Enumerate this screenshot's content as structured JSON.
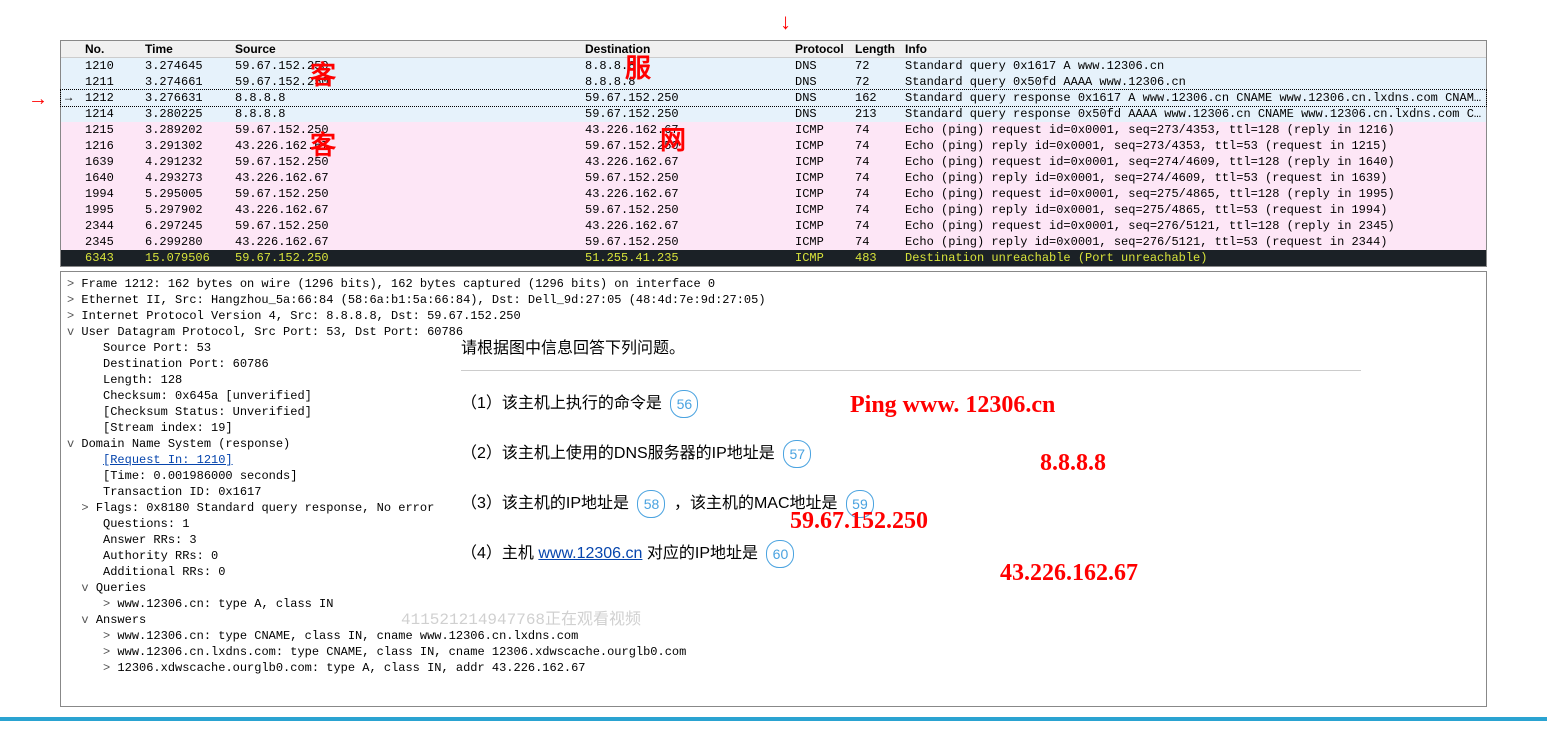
{
  "columns": {
    "no": "No.",
    "time": "Time",
    "source": "Source",
    "destination": "Destination",
    "protocol": "Protocol",
    "length": "Length",
    "info": "Info"
  },
  "packets": [
    {
      "no": "1210",
      "time": "3.274645",
      "src": "59.67.152.250",
      "dst": "8.8.8.8",
      "proto": "DNS",
      "len": "72",
      "info": "Standard query 0x1617 A www.12306.cn",
      "cls": "row-blue"
    },
    {
      "no": "1211",
      "time": "3.274661",
      "src": "59.67.152.250",
      "dst": "8.8.8.8",
      "proto": "DNS",
      "len": "72",
      "info": "Standard query 0x50fd AAAA www.12306.cn",
      "cls": "row-blue"
    },
    {
      "no": "1212",
      "time": "3.276631",
      "src": "8.8.8.8",
      "dst": "59.67.152.250",
      "proto": "DNS",
      "len": "162",
      "info": "Standard query response 0x1617 A www.12306.cn CNAME www.12306.cn.lxdns.com CNAME 12306.xdwscache.ourglb0.com …",
      "cls": "row-blue selected"
    },
    {
      "no": "1214",
      "time": "3.280225",
      "src": "8.8.8.8",
      "dst": "59.67.152.250",
      "proto": "DNS",
      "len": "213",
      "info": "Standard query response 0x50fd AAAA www.12306.cn CNAME www.12306.cn.lxdns.com CNAME 12306.xdwscache.ourglb0.c…",
      "cls": "row-blue"
    },
    {
      "no": "1215",
      "time": "3.289202",
      "src": "59.67.152.250",
      "dst": "43.226.162.67",
      "proto": "ICMP",
      "len": "74",
      "info": "Echo (ping) request  id=0x0001, seq=273/4353, ttl=128 (reply in 1216)",
      "cls": "row-pink"
    },
    {
      "no": "1216",
      "time": "3.291302",
      "src": "43.226.162.67",
      "dst": "59.67.152.250",
      "proto": "ICMP",
      "len": "74",
      "info": "Echo (ping) reply    id=0x0001, seq=273/4353, ttl=53 (request in 1215)",
      "cls": "row-pink"
    },
    {
      "no": "1639",
      "time": "4.291232",
      "src": "59.67.152.250",
      "dst": "43.226.162.67",
      "proto": "ICMP",
      "len": "74",
      "info": "Echo (ping) request  id=0x0001, seq=274/4609, ttl=128 (reply in 1640)",
      "cls": "row-pink"
    },
    {
      "no": "1640",
      "time": "4.293273",
      "src": "43.226.162.67",
      "dst": "59.67.152.250",
      "proto": "ICMP",
      "len": "74",
      "info": "Echo (ping) reply    id=0x0001, seq=274/4609, ttl=53 (request in 1639)",
      "cls": "row-pink"
    },
    {
      "no": "1994",
      "time": "5.295005",
      "src": "59.67.152.250",
      "dst": "43.226.162.67",
      "proto": "ICMP",
      "len": "74",
      "info": "Echo (ping) request  id=0x0001, seq=275/4865, ttl=128 (reply in 1995)",
      "cls": "row-pink"
    },
    {
      "no": "1995",
      "time": "5.297902",
      "src": "43.226.162.67",
      "dst": "59.67.152.250",
      "proto": "ICMP",
      "len": "74",
      "info": "Echo (ping) reply    id=0x0001, seq=275/4865, ttl=53 (request in 1994)",
      "cls": "row-pink"
    },
    {
      "no": "2344",
      "time": "6.297245",
      "src": "59.67.152.250",
      "dst": "43.226.162.67",
      "proto": "ICMP",
      "len": "74",
      "info": "Echo (ping) request  id=0x0001, seq=276/5121, ttl=128 (reply in 2345)",
      "cls": "row-pink"
    },
    {
      "no": "2345",
      "time": "6.299280",
      "src": "43.226.162.67",
      "dst": "59.67.152.250",
      "proto": "ICMP",
      "len": "74",
      "info": "Echo (ping) reply    id=0x0001, seq=276/5121, ttl=53 (request in 2344)",
      "cls": "row-pink"
    },
    {
      "no": "6343",
      "time": "15.079506",
      "src": "59.67.152.250",
      "dst": "51.255.41.235",
      "proto": "ICMP",
      "len": "483",
      "info": "Destination unreachable (Port unreachable)",
      "cls": "row-dark"
    }
  ],
  "tree": {
    "frame": "Frame 1212: 162 bytes on wire (1296 bits), 162 bytes captured (1296 bits) on interface 0",
    "eth": "Ethernet II, Src: Hangzhou_5a:66:84 (58:6a:b1:5a:66:84), Dst: Dell_9d:27:05 (48:4d:7e:9d:27:05)",
    "ip": "Internet Protocol Version 4, Src: 8.8.8.8, Dst: 59.67.152.250",
    "udp": "User Datagram Protocol, Src Port: 53, Dst Port: 60786",
    "srcport": "Source Port: 53",
    "dstport": "Destination Port: 60786",
    "length": "Length: 128",
    "cksum": "Checksum: 0x645a [unverified]",
    "ckstat": "[Checksum Status: Unverified]",
    "stream": "[Stream index: 19]",
    "dns": "Domain Name System (response)",
    "reqin": "[Request In: 1210]",
    "time": "[Time: 0.001986000 seconds]",
    "tid": "Transaction ID: 0x1617",
    "flags": "Flags: 0x8180 Standard query response, No error",
    "qcount": "Questions: 1",
    "arrs": "Answer RRs: 3",
    "aurrs": "Authority RRs: 0",
    "adrrs": "Additional RRs: 0",
    "queries": "Queries",
    "query0": "www.12306.cn: type A, class IN",
    "answers": "Answers",
    "ans0": "www.12306.cn: type CNAME, class IN, cname www.12306.cn.lxdns.com",
    "ans1": "www.12306.cn.lxdns.com: type CNAME, class IN, cname 12306.xdwscache.ourglb0.com",
    "ans2": "12306.xdwscache.ourglb0.com: type A, class IN, addr 43.226.162.67"
  },
  "questions": {
    "prompt": "请根据图中信息回答下列问题。",
    "q1_pre": "（1）该主机上执行的命令是",
    "q1_num": "56",
    "q2_pre": "（2）该主机上使用的DNS服务器的IP地址是",
    "q2_num": "57",
    "q3_pre": "（3）该主机的IP地址是",
    "q3_num": "58",
    "q3_mid": "，该主机的MAC地址是",
    "q3_num2": "59",
    "q4_pre": "（4）主机",
    "q4_link": "www.12306.cn",
    "q4_post": "对应的IP地址是",
    "q4_num": "60"
  },
  "annotations": {
    "client": "客",
    "server": "服",
    "net": "网",
    "arrow": "→",
    "a1": "Ping  www. 12306.cn",
    "a2": "8.8.8.8",
    "a3": "59.67.152.250",
    "a4": "43.226.162.67"
  },
  "watermark": "411521214947768正在观看视频"
}
